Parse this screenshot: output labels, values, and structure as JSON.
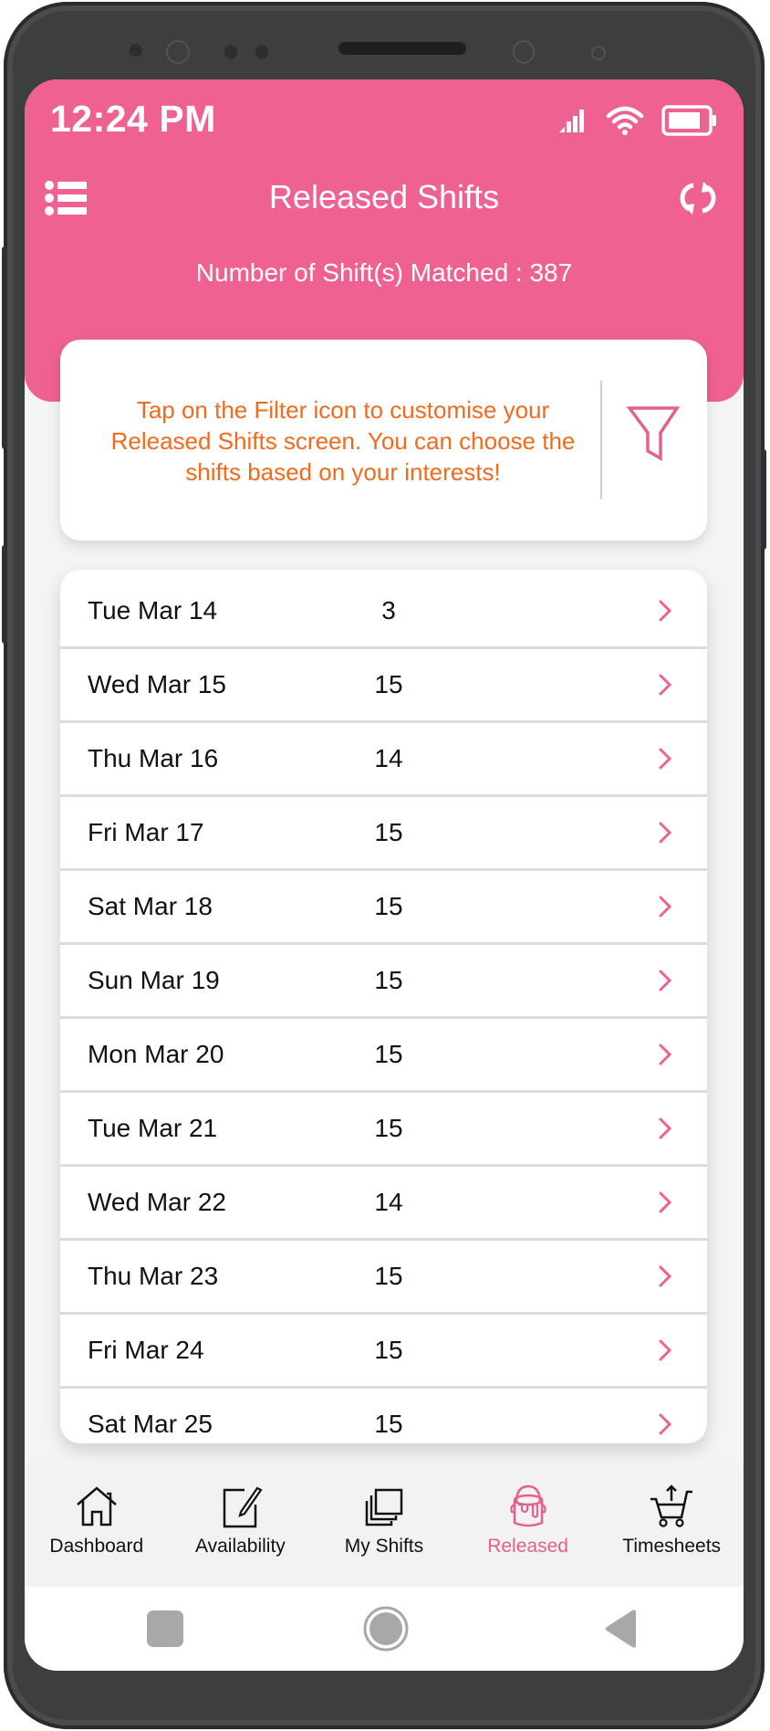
{
  "colors": {
    "brand_pink": "#ef6191",
    "accent_orange": "#f26a1b",
    "active_nav": "#e5608e"
  },
  "status_bar": {
    "time": "12:24 PM",
    "icons": [
      "signal-icon",
      "wifi-icon",
      "battery-icon"
    ]
  },
  "header": {
    "title": "Released Shifts",
    "menu_icon": "list-menu-icon",
    "refresh_icon": "refresh-icon",
    "count_label": "Number of Shift(s) Matched : 387"
  },
  "filter_card": {
    "message": "Tap on the Filter icon to customise your Released Shifts screen. You can choose the shifts based on your interests!",
    "icon": "filter-funnel-icon"
  },
  "shift_days": [
    {
      "date": "Tue Mar 14",
      "count": "3"
    },
    {
      "date": "Wed Mar 15",
      "count": "15"
    },
    {
      "date": "Thu Mar 16",
      "count": "14"
    },
    {
      "date": "Fri Mar 17",
      "count": "15"
    },
    {
      "date": "Sat Mar 18",
      "count": "15"
    },
    {
      "date": "Sun Mar 19",
      "count": "15"
    },
    {
      "date": "Mon Mar 20",
      "count": "15"
    },
    {
      "date": "Tue Mar 21",
      "count": "15"
    },
    {
      "date": "Wed Mar 22",
      "count": "14"
    },
    {
      "date": "Thu Mar 23",
      "count": "15"
    },
    {
      "date": "Fri Mar 24",
      "count": "15"
    },
    {
      "date": "Sat Mar 25",
      "count": "15"
    }
  ],
  "bottom_nav": {
    "items": [
      {
        "label": "Dashboard",
        "icon": "home-icon",
        "active": false
      },
      {
        "label": "Availability",
        "icon": "edit-note-icon",
        "active": false
      },
      {
        "label": "My Shifts",
        "icon": "stacked-pages-icon",
        "active": false
      },
      {
        "label": "Released",
        "icon": "paint-bucket-icon",
        "active": true
      },
      {
        "label": "Timesheets",
        "icon": "cart-upload-icon",
        "active": false
      }
    ]
  },
  "system_nav": {
    "buttons": [
      "recents-square-icon",
      "home-circle-icon",
      "back-triangle-icon"
    ]
  }
}
